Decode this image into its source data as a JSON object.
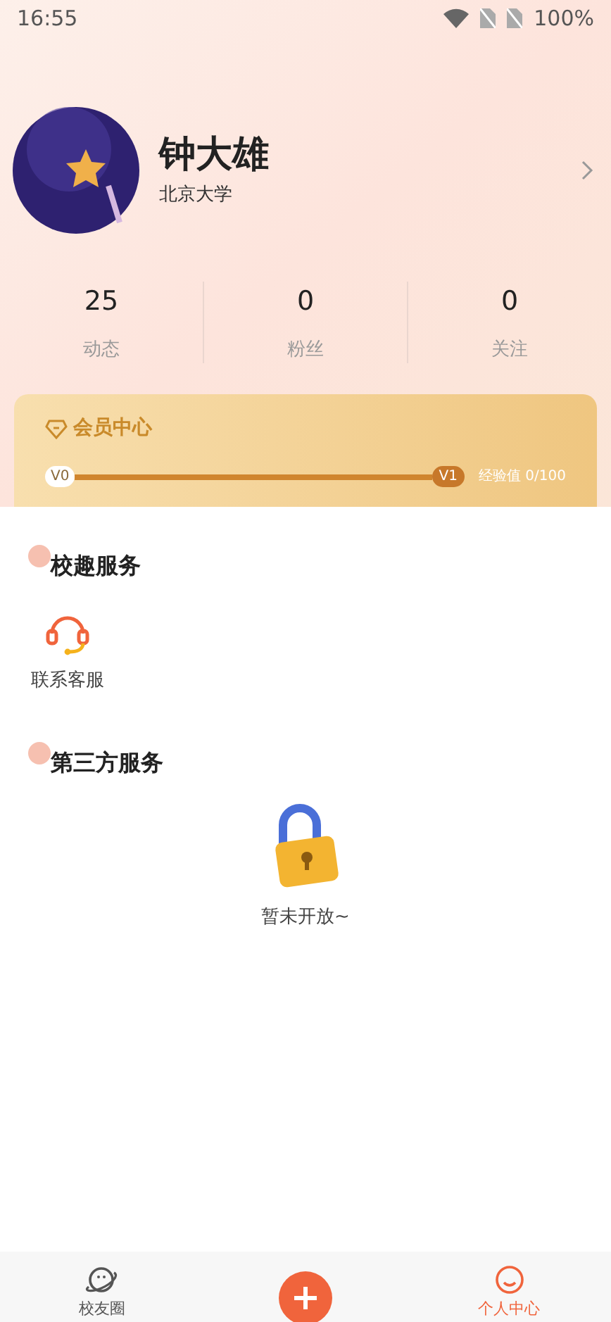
{
  "status_bar": {
    "time": "16:55",
    "battery": "100%"
  },
  "profile": {
    "name": "钟大雄",
    "school": "北京大学"
  },
  "stats": [
    {
      "value": "25",
      "label": "动态"
    },
    {
      "value": "0",
      "label": "粉丝"
    },
    {
      "value": "0",
      "label": "关注"
    }
  ],
  "membership": {
    "title": "会员中心",
    "from_level": "V0",
    "to_level": "V1",
    "experience": "经验值 0/100"
  },
  "sections": [
    {
      "title": "校趣服务",
      "kind": "grid",
      "items": [
        {
          "label": "联系客服"
        }
      ]
    },
    {
      "title": "第三方服务",
      "kind": "locked",
      "message": "暂未开放~"
    }
  ],
  "tab_bar": [
    {
      "label": "校友圈",
      "kind": "planet",
      "selected": false
    },
    {
      "kind": "add",
      "selected": false
    },
    {
      "label": "个人中心",
      "kind": "smile",
      "selected": true
    }
  ]
}
